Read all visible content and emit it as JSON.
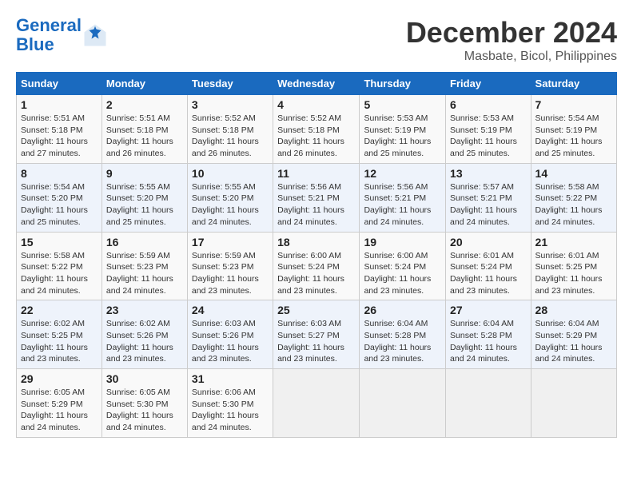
{
  "header": {
    "logo_line1": "General",
    "logo_line2": "Blue",
    "month": "December 2024",
    "location": "Masbate, Bicol, Philippines"
  },
  "weekdays": [
    "Sunday",
    "Monday",
    "Tuesday",
    "Wednesday",
    "Thursday",
    "Friday",
    "Saturday"
  ],
  "weeks": [
    [
      {
        "day": "1",
        "rise": "5:51 AM",
        "set": "5:18 PM",
        "daylight": "11 hours and 27 minutes."
      },
      {
        "day": "2",
        "rise": "5:51 AM",
        "set": "5:18 PM",
        "daylight": "11 hours and 26 minutes."
      },
      {
        "day": "3",
        "rise": "5:52 AM",
        "set": "5:18 PM",
        "daylight": "11 hours and 26 minutes."
      },
      {
        "day": "4",
        "rise": "5:52 AM",
        "set": "5:18 PM",
        "daylight": "11 hours and 26 minutes."
      },
      {
        "day": "5",
        "rise": "5:53 AM",
        "set": "5:19 PM",
        "daylight": "11 hours and 25 minutes."
      },
      {
        "day": "6",
        "rise": "5:53 AM",
        "set": "5:19 PM",
        "daylight": "11 hours and 25 minutes."
      },
      {
        "day": "7",
        "rise": "5:54 AM",
        "set": "5:19 PM",
        "daylight": "11 hours and 25 minutes."
      }
    ],
    [
      {
        "day": "8",
        "rise": "5:54 AM",
        "set": "5:20 PM",
        "daylight": "11 hours and 25 minutes."
      },
      {
        "day": "9",
        "rise": "5:55 AM",
        "set": "5:20 PM",
        "daylight": "11 hours and 25 minutes."
      },
      {
        "day": "10",
        "rise": "5:55 AM",
        "set": "5:20 PM",
        "daylight": "11 hours and 24 minutes."
      },
      {
        "day": "11",
        "rise": "5:56 AM",
        "set": "5:21 PM",
        "daylight": "11 hours and 24 minutes."
      },
      {
        "day": "12",
        "rise": "5:56 AM",
        "set": "5:21 PM",
        "daylight": "11 hours and 24 minutes."
      },
      {
        "day": "13",
        "rise": "5:57 AM",
        "set": "5:21 PM",
        "daylight": "11 hours and 24 minutes."
      },
      {
        "day": "14",
        "rise": "5:58 AM",
        "set": "5:22 PM",
        "daylight": "11 hours and 24 minutes."
      }
    ],
    [
      {
        "day": "15",
        "rise": "5:58 AM",
        "set": "5:22 PM",
        "daylight": "11 hours and 24 minutes."
      },
      {
        "day": "16",
        "rise": "5:59 AM",
        "set": "5:23 PM",
        "daylight": "11 hours and 24 minutes."
      },
      {
        "day": "17",
        "rise": "5:59 AM",
        "set": "5:23 PM",
        "daylight": "11 hours and 23 minutes."
      },
      {
        "day": "18",
        "rise": "6:00 AM",
        "set": "5:24 PM",
        "daylight": "11 hours and 23 minutes."
      },
      {
        "day": "19",
        "rise": "6:00 AM",
        "set": "5:24 PM",
        "daylight": "11 hours and 23 minutes."
      },
      {
        "day": "20",
        "rise": "6:01 AM",
        "set": "5:24 PM",
        "daylight": "11 hours and 23 minutes."
      },
      {
        "day": "21",
        "rise": "6:01 AM",
        "set": "5:25 PM",
        "daylight": "11 hours and 23 minutes."
      }
    ],
    [
      {
        "day": "22",
        "rise": "6:02 AM",
        "set": "5:25 PM",
        "daylight": "11 hours and 23 minutes."
      },
      {
        "day": "23",
        "rise": "6:02 AM",
        "set": "5:26 PM",
        "daylight": "11 hours and 23 minutes."
      },
      {
        "day": "24",
        "rise": "6:03 AM",
        "set": "5:26 PM",
        "daylight": "11 hours and 23 minutes."
      },
      {
        "day": "25",
        "rise": "6:03 AM",
        "set": "5:27 PM",
        "daylight": "11 hours and 23 minutes."
      },
      {
        "day": "26",
        "rise": "6:04 AM",
        "set": "5:28 PM",
        "daylight": "11 hours and 23 minutes."
      },
      {
        "day": "27",
        "rise": "6:04 AM",
        "set": "5:28 PM",
        "daylight": "11 hours and 24 minutes."
      },
      {
        "day": "28",
        "rise": "6:04 AM",
        "set": "5:29 PM",
        "daylight": "11 hours and 24 minutes."
      }
    ],
    [
      {
        "day": "29",
        "rise": "6:05 AM",
        "set": "5:29 PM",
        "daylight": "11 hours and 24 minutes."
      },
      {
        "day": "30",
        "rise": "6:05 AM",
        "set": "5:30 PM",
        "daylight": "11 hours and 24 minutes."
      },
      {
        "day": "31",
        "rise": "6:06 AM",
        "set": "5:30 PM",
        "daylight": "11 hours and 24 minutes."
      },
      null,
      null,
      null,
      null
    ]
  ]
}
